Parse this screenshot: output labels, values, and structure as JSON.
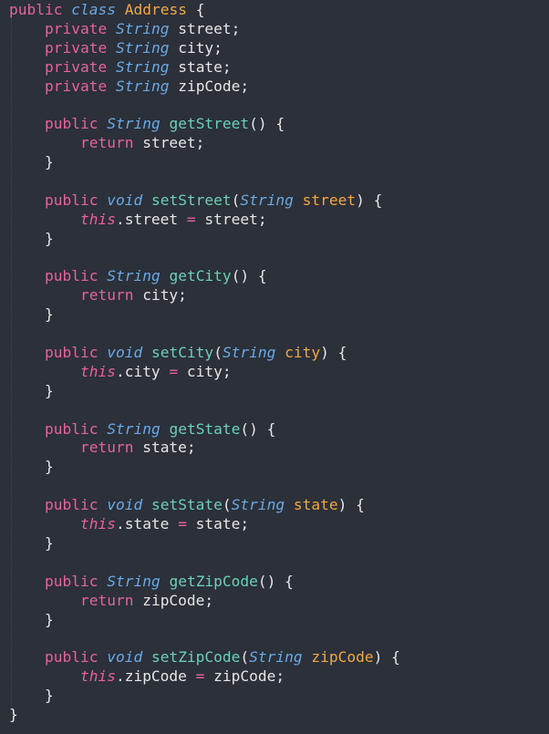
{
  "editor": {
    "lines": [
      [
        "kw:public",
        "plain: ",
        "type:class",
        "plain: ",
        "cls:Address",
        "plain: {"
      ],
      [
        "plain:    ",
        "kw:private",
        "plain: ",
        "type:String",
        "plain: street;"
      ],
      [
        "plain:    ",
        "kw:private",
        "plain: ",
        "type:String",
        "plain: city;"
      ],
      [
        "plain:    ",
        "kw:private",
        "plain: ",
        "type:String",
        "plain: state;"
      ],
      [
        "plain:    ",
        "kw:private",
        "plain: ",
        "type:String",
        "plain: zipCode;"
      ],
      [],
      [
        "plain:    ",
        "kw:public",
        "plain: ",
        "type:String",
        "plain: ",
        "fn:getStreet",
        "plain:() {"
      ],
      [
        "plain:        ",
        "kw:return",
        "plain: street;"
      ],
      [
        "plain:    }"
      ],
      [],
      [
        "plain:    ",
        "kw:public",
        "plain: ",
        "type:void",
        "plain: ",
        "fn:setStreet",
        "plain:(",
        "type:String",
        "plain: ",
        "param:street",
        "plain:) {"
      ],
      [
        "plain:        ",
        "self:this",
        "plain:.street ",
        "op:=",
        "plain: street;"
      ],
      [
        "plain:    }"
      ],
      [],
      [
        "plain:    ",
        "kw:public",
        "plain: ",
        "type:String",
        "plain: ",
        "fn:getCity",
        "plain:() {"
      ],
      [
        "plain:        ",
        "kw:return",
        "plain: city;"
      ],
      [
        "plain:    }"
      ],
      [],
      [
        "plain:    ",
        "kw:public",
        "plain: ",
        "type:void",
        "plain: ",
        "fn:setCity",
        "plain:(",
        "type:String",
        "plain: ",
        "param:city",
        "plain:) {"
      ],
      [
        "plain:        ",
        "self:this",
        "plain:.city ",
        "op:=",
        "plain: city;"
      ],
      [
        "plain:    }"
      ],
      [],
      [
        "plain:    ",
        "kw:public",
        "plain: ",
        "type:String",
        "plain: ",
        "fn:getState",
        "plain:() {"
      ],
      [
        "plain:        ",
        "kw:return",
        "plain: state;"
      ],
      [
        "plain:    }"
      ],
      [],
      [
        "plain:    ",
        "kw:public",
        "plain: ",
        "type:void",
        "plain: ",
        "fn:setState",
        "plain:(",
        "type:String",
        "plain: ",
        "param:state",
        "plain:) {"
      ],
      [
        "plain:        ",
        "self:this",
        "plain:.state ",
        "op:=",
        "plain: state;"
      ],
      [
        "plain:    }"
      ],
      [],
      [
        "plain:    ",
        "kw:public",
        "plain: ",
        "type:String",
        "plain: ",
        "fn:getZipCode",
        "plain:() {"
      ],
      [
        "plain:        ",
        "kw:return",
        "plain: zipCode;"
      ],
      [
        "plain:    }"
      ],
      [],
      [
        "plain:    ",
        "kw:public",
        "plain: ",
        "type:void",
        "plain: ",
        "fn:setZipCode",
        "plain:(",
        "type:String",
        "plain: ",
        "param:zipCode",
        "plain:) {"
      ],
      [
        "plain:        ",
        "self:this",
        "plain:.zipCode ",
        "op:=",
        "plain: zipCode;"
      ],
      [
        "plain:    }"
      ],
      [
        "plain:}"
      ]
    ]
  },
  "colors": {
    "background": "#2b3039",
    "keyword": "#e6639b",
    "type": "#6aa9e6",
    "class_name": "#f5a742",
    "function_name": "#6bd1b3",
    "parameter": "#f5a742",
    "plain_text": "#e6e6e6"
  }
}
